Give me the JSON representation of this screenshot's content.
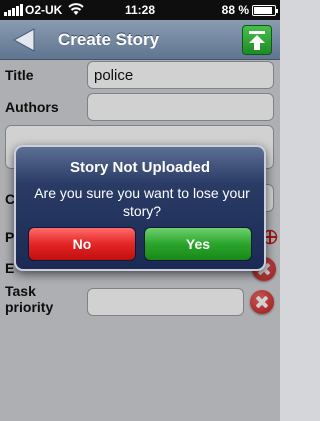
{
  "status_bar": {
    "carrier": "O2-UK",
    "time": "11:28",
    "battery_percent": "88 %",
    "battery_level": 0.88
  },
  "nav": {
    "title": "Create Story"
  },
  "form": {
    "title_label": "Title",
    "title_value": "police",
    "authors_label": "Authors",
    "partial_label_c": "C",
    "partial_label_p": "P",
    "partial_label_e": "E",
    "task_priority_label_1": "Task",
    "task_priority_label_2": "priority"
  },
  "alert": {
    "title": "Story Not Uploaded",
    "message": "Are you sure you want to lose your story?",
    "no_label": "No",
    "yes_label": "Yes"
  },
  "colors": {
    "no_button": "#e32525",
    "yes_button": "#2ba52b",
    "nav_bar": "#7388a2",
    "alert_bg": "#1a2a55"
  }
}
